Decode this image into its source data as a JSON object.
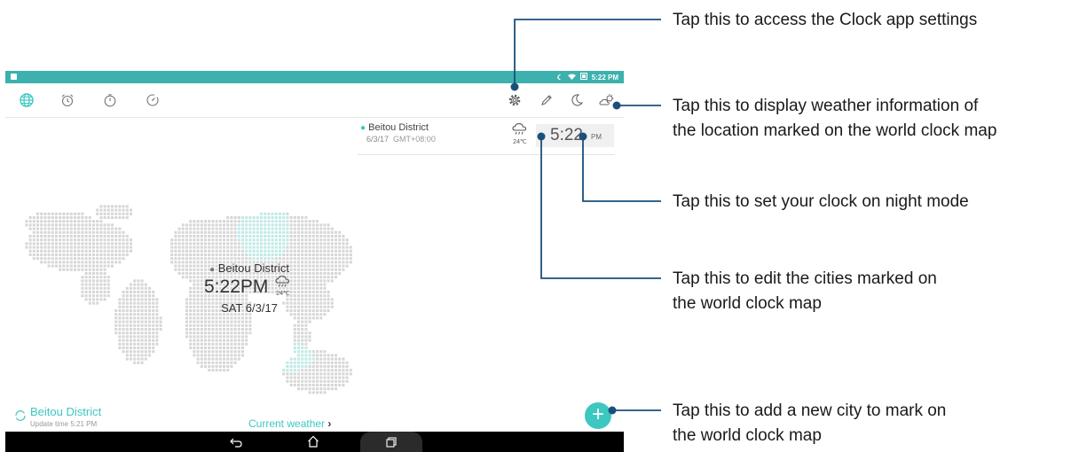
{
  "annotations": {
    "settings": "Tap this to access the Clock app settings",
    "weather_1": "Tap this to display weather information of",
    "weather_2": "the location marked on the world clock map",
    "night": "Tap this to set your clock on night mode",
    "edit_1": "Tap this to edit the cities marked on",
    "edit_2": "the world clock map",
    "add_1": "Tap this to add a new city to mark on",
    "add_2": "the world clock map"
  },
  "status_bar": {
    "time": "5:22 PM",
    "color": "#3cb1ad"
  },
  "toolbar": {
    "tabs": [
      "globe-icon",
      "alarm-clock-icon",
      "stopwatch-icon",
      "timer-icon"
    ],
    "actions": [
      "gear-icon",
      "pencil-icon",
      "moon-icon",
      "weather-icon"
    ],
    "accent": "#3cc7c1"
  },
  "city_card": {
    "name": "Beitou District",
    "date": "6/3/17",
    "gmt": "GMT+08:00",
    "temp": "24℃",
    "time": "5:22",
    "ampm": "PM"
  },
  "map_marker": {
    "name": "Beitou District",
    "time": "5:22PM",
    "temp": "24℃",
    "date": "SAT 6/3/17"
  },
  "footer": {
    "location": "Beitou District",
    "update": "Update time 5:21 PM",
    "current_weather": "Current weather"
  },
  "fab": {
    "label": "+"
  },
  "navbar": [
    "back-icon",
    "home-icon",
    "recent-apps-icon"
  ]
}
